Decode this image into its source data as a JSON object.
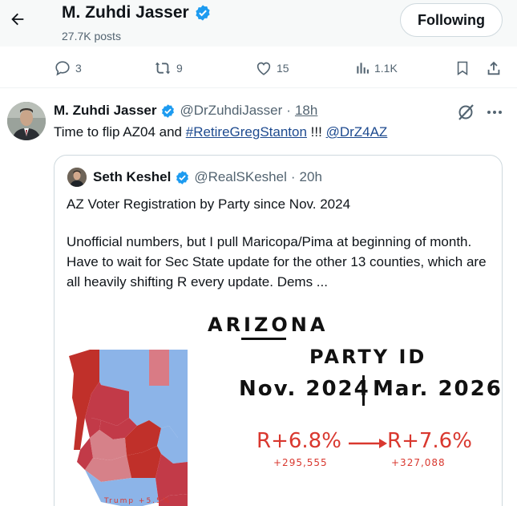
{
  "header": {
    "profile_name": "M. Zuhdi Jasser",
    "posts": "27.7K posts",
    "follow_label": "Following"
  },
  "actions": {
    "replies": "3",
    "reposts": "9",
    "likes": "15",
    "views": "1.1K"
  },
  "tweet": {
    "author": "M. Zuhdi Jasser",
    "handle": "@DrZuhdiJasser",
    "separator": "·",
    "time": "18h",
    "text_prefix": "Time to flip AZ04 and ",
    "hashtag": "#RetireGregStanton",
    "text_middle": " !!! ",
    "mention": "@DrZ4AZ"
  },
  "quote": {
    "author": "Seth Keshel",
    "handle": "@RealSKeshel",
    "separator": "·",
    "time": "20h",
    "line1": "AZ Voter Registration by Party since Nov. 2024",
    "line2": "Unofficial numbers, but I pull Maricopa/Pima at beginning of month.  Have to wait for Sec State update for the other 13 counties, which are all heavily shifting R every update.  Dems ..."
  },
  "graphic": {
    "title_prefix": "ARI",
    "title_zo": "ZO",
    "title_suffix": "NA",
    "subtitle": "PARTY ID",
    "from_date": "Nov. 2024",
    "to_date": "Mar. 2026",
    "from_value": "R+6.8%",
    "to_value": "R+7.6%",
    "from_count": "+295,555",
    "to_count": "+327,088",
    "map_caption": "Trump +5.5%",
    "red_color": "#d9382f",
    "map_red": "#c0302a",
    "map_blue": "#8cb4e8"
  }
}
